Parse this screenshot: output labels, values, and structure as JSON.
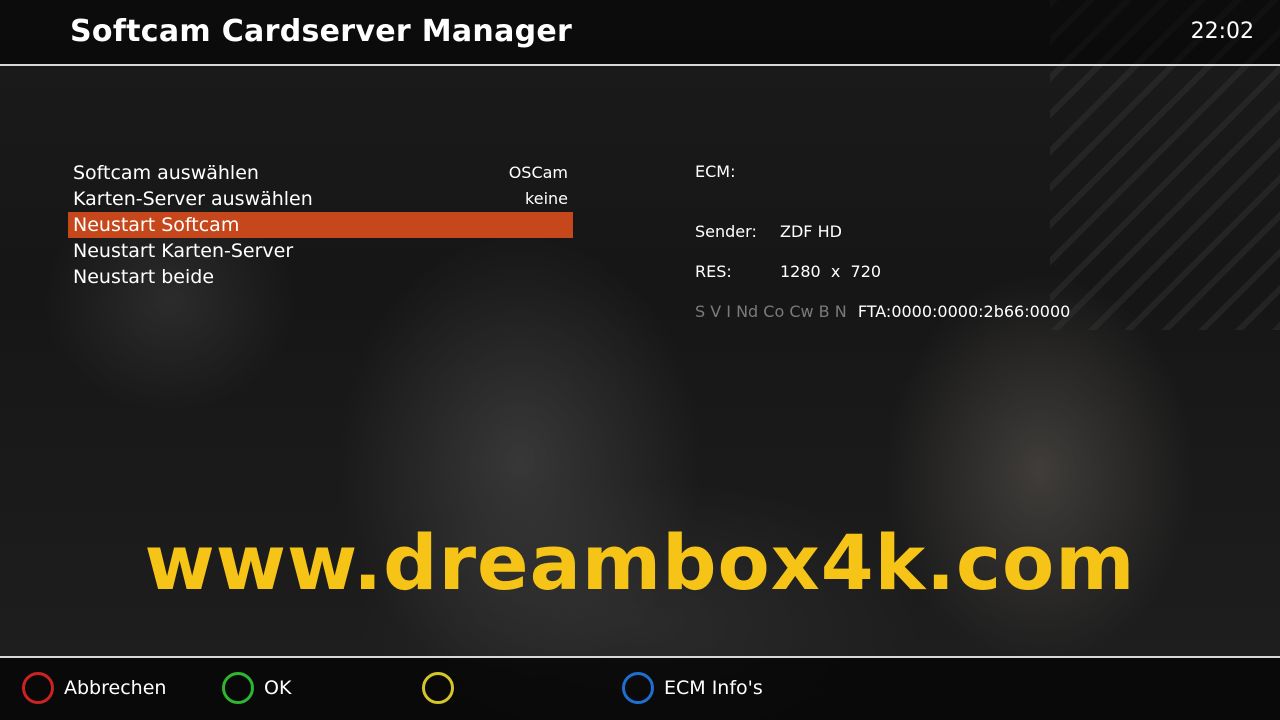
{
  "header": {
    "title": "Softcam Cardserver Manager",
    "clock": "22:02"
  },
  "menu": {
    "items": [
      {
        "label": "Softcam auswählen",
        "value": "OSCam",
        "selected": false
      },
      {
        "label": "Karten-Server auswählen",
        "value": "keine",
        "selected": false
      },
      {
        "label": "Neustart Softcam",
        "value": "",
        "selected": true
      },
      {
        "label": "Neustart Karten-Server",
        "value": "",
        "selected": false
      },
      {
        "label": "Neustart beide",
        "value": "",
        "selected": false
      }
    ]
  },
  "info": {
    "ecm_label": "ECM:",
    "sender_label": "Sender:",
    "sender_value": "ZDF HD",
    "res_label": "RES:",
    "res_value": "1280  x  720",
    "caid_labels": "S V I Nd Co Cw B N",
    "caid_value": "FTA:0000:0000:2b66:0000"
  },
  "watermark": "www.dreambox4k.com",
  "footer": {
    "keys": [
      {
        "label": "Abbrechen",
        "color": "#cc2222",
        "icon": "red-button-icon"
      },
      {
        "label": "OK",
        "color": "#2fb52f",
        "icon": "green-button-icon"
      },
      {
        "label": "",
        "color": "#d4c62a",
        "icon": "yellow-button-icon"
      },
      {
        "label": "ECM Info's",
        "color": "#1f6fd0",
        "icon": "blue-button-icon"
      }
    ]
  },
  "colors": {
    "selection": "#c5471b",
    "watermark": "#f5c417"
  }
}
